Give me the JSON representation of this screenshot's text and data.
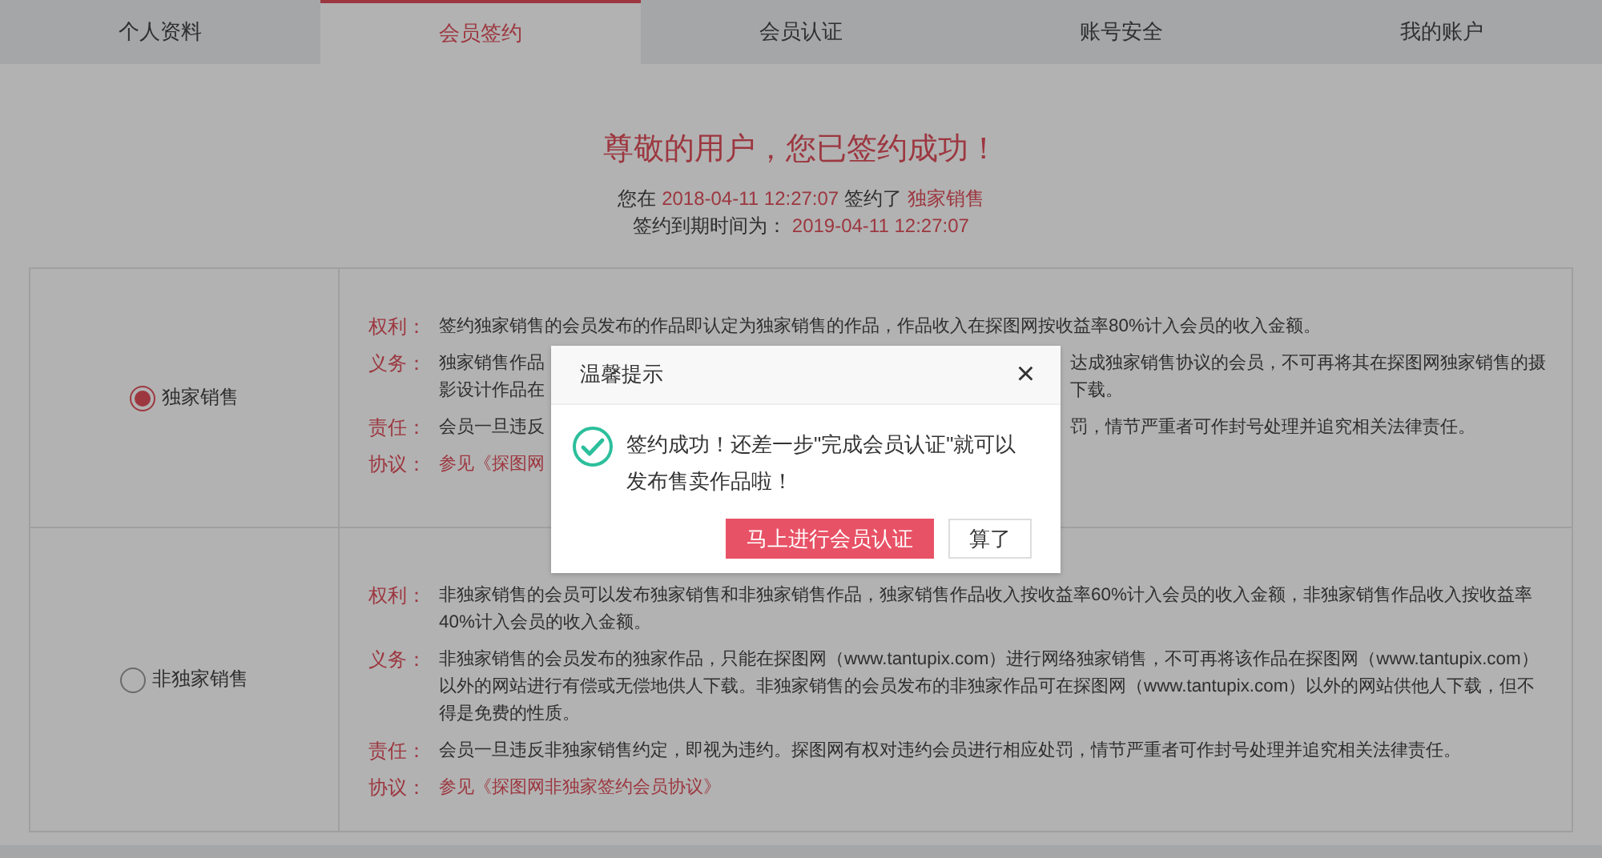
{
  "tabs": [
    {
      "label": "个人资料",
      "selected": false
    },
    {
      "label": "会员签约",
      "selected": true
    },
    {
      "label": "会员认证",
      "selected": false
    },
    {
      "label": "账号安全",
      "selected": false
    },
    {
      "label": "我的账户",
      "selected": false
    }
  ],
  "heading": "尊敬的用户，您已签约成功！",
  "sign_info": {
    "prefix": "您在",
    "signed_at": "2018-04-11 12:27:07",
    "middle": "签约了",
    "plan": "独家销售",
    "expiry_label": "签约到期时间为：",
    "expires_at": "2019-04-11 12:27:07"
  },
  "plans": [
    {
      "name": "独家销售",
      "selected": true,
      "terms": [
        {
          "label": "权利：",
          "kind": "text",
          "lines": [
            {
              "text": "签约独家销售的会员发布的作品即认定为独家销售的作品，作品收入在探图网按收益率80%计入会员的收入金额。"
            }
          ]
        },
        {
          "label": "义务：",
          "kind": "text",
          "lines": [
            {
              "text": "独家销售作品",
              "text_after": "达成独家销售协议的会员，不可再将其在探图网独家销售的摄"
            },
            {
              "text": "影设计作品在",
              "text_after": "下载。"
            }
          ]
        },
        {
          "label": "责任：",
          "kind": "text",
          "lines": [
            {
              "text": "会员一旦违反",
              "text_after": "罚，情节严重者可作封号处理并追究相关法律责任。"
            }
          ]
        },
        {
          "label": "协议：",
          "kind": "link",
          "lines": [
            {
              "text": "参见《探图网"
            }
          ]
        }
      ]
    },
    {
      "name": "非独家销售",
      "selected": false,
      "terms": [
        {
          "label": "权利：",
          "kind": "text",
          "lines": [
            {
              "text": "非独家销售的会员可以发布独家销售和非独家销售作品，独家销售作品收入按收益率60%计入会员的收入金额，非独家销售作品收入按收益率"
            },
            {
              "text": "40%计入会员的收入金额。"
            }
          ]
        },
        {
          "label": "义务：",
          "kind": "text",
          "lines": [
            {
              "text": "非独家销售的会员发布的独家作品，只能在探图网（www.tantupix.com）进行网络独家销售，不可再将该作品在探图网（www.tantupix.com）"
            },
            {
              "text": "以外的网站进行有偿或无偿地供人下载。非独家销售的会员发布的非独家作品可在探图网（www.tantupix.com）以外的网站供他人下载，但不"
            },
            {
              "text": "得是免费的性质。"
            }
          ]
        },
        {
          "label": "责任：",
          "kind": "text",
          "lines": [
            {
              "text": "会员一旦违反非独家销售约定，即视为违约。探图网有权对违约会员进行相应处罚，情节严重者可作封号处理并追究相关法律责任。"
            }
          ]
        },
        {
          "label": "协议：",
          "kind": "link",
          "lines": [
            {
              "text": "参见《探图网非独家签约会员协议》"
            }
          ]
        }
      ]
    }
  ],
  "dialog": {
    "title": "温馨提示",
    "close": "×",
    "message": "签约成功！还差一步\"完成会员认证\"就可以发布售卖作品啦！",
    "buttons": [
      {
        "label": "马上进行会员认证",
        "kind": "primary"
      },
      {
        "label": "算了",
        "kind": "secondary"
      }
    ]
  }
}
